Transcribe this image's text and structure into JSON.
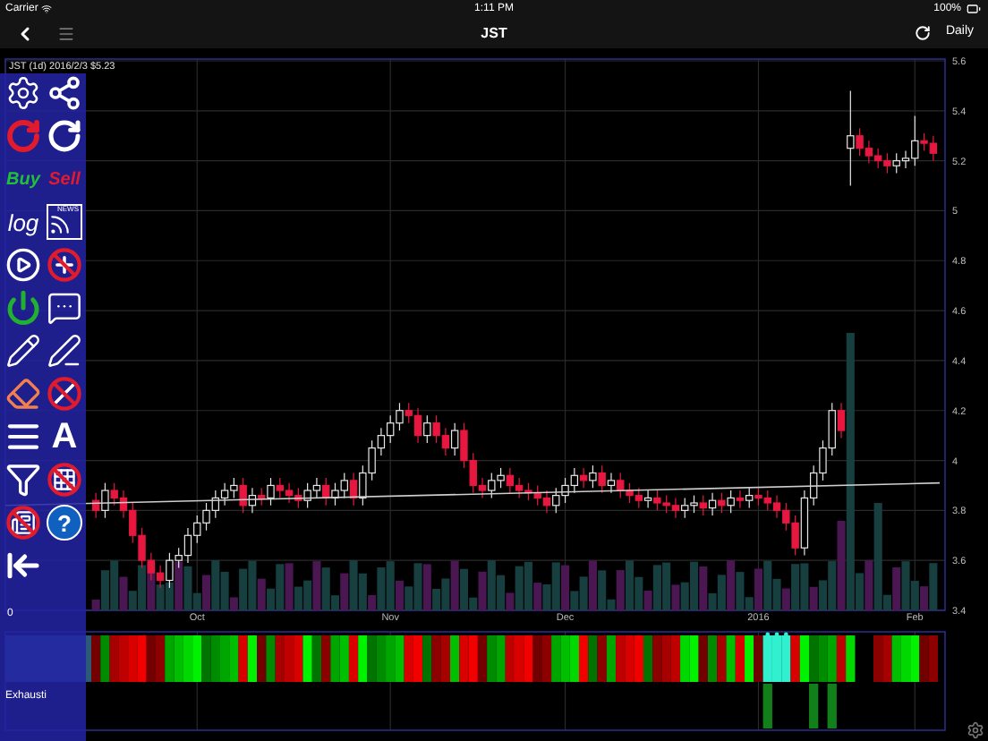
{
  "status_bar": {
    "carrier": "Carrier",
    "time": "1:11 PM",
    "battery": "100%"
  },
  "nav": {
    "title": "JST",
    "interval": "Daily"
  },
  "toolbar": {
    "buy": "Buy",
    "sell": "Sell",
    "log": "log",
    "news": "NEWS",
    "font": "A",
    "help": "?"
  },
  "chart": {
    "zero_label": "0",
    "chart_data": {
      "type": "candlestick",
      "title": "JST (1d) 2016/2/3 $5.23",
      "categories": [
        null,
        null,
        null,
        null,
        null,
        null,
        null,
        null,
        null,
        null,
        null,
        "Oct",
        null,
        null,
        null,
        null,
        null,
        null,
        null,
        null,
        null,
        null,
        null,
        null,
        null,
        null,
        null,
        null,
        null,
        null,
        null,
        null,
        "Nov",
        null,
        null,
        null,
        null,
        null,
        null,
        null,
        null,
        null,
        null,
        null,
        null,
        null,
        null,
        null,
        null,
        null,
        null,
        "Dec",
        null,
        null,
        null,
        null,
        null,
        null,
        null,
        null,
        null,
        null,
        null,
        null,
        null,
        null,
        null,
        null,
        null,
        null,
        null,
        null,
        "2016",
        null,
        null,
        null,
        null,
        null,
        null,
        null,
        null,
        null,
        null,
        null,
        null,
        null,
        null,
        null,
        null,
        "Feb",
        null,
        null
      ],
      "ohlc": [
        [
          3.84,
          3.87,
          3.77,
          3.8
        ],
        [
          3.8,
          3.91,
          3.77,
          3.88
        ],
        [
          3.88,
          3.91,
          3.82,
          3.85
        ],
        [
          3.85,
          3.88,
          3.77,
          3.8
        ],
        [
          3.8,
          3.83,
          3.67,
          3.7
        ],
        [
          3.7,
          3.73,
          3.57,
          3.6
        ],
        [
          3.6,
          3.63,
          3.52,
          3.55
        ],
        [
          3.55,
          3.58,
          3.49,
          3.52
        ],
        [
          3.52,
          3.63,
          3.49,
          3.6
        ],
        [
          3.6,
          3.65,
          3.57,
          3.62
        ],
        [
          3.62,
          3.73,
          3.59,
          3.7
        ],
        [
          3.7,
          3.78,
          3.67,
          3.75
        ],
        [
          3.75,
          3.83,
          3.72,
          3.8
        ],
        [
          3.8,
          3.88,
          3.77,
          3.85
        ],
        [
          3.85,
          3.91,
          3.82,
          3.88
        ],
        [
          3.88,
          3.93,
          3.85,
          3.9
        ],
        [
          3.9,
          3.93,
          3.79,
          3.82
        ],
        [
          3.82,
          3.89,
          3.79,
          3.86
        ],
        [
          3.86,
          3.89,
          3.82,
          3.85
        ],
        [
          3.85,
          3.93,
          3.82,
          3.9
        ],
        [
          3.9,
          3.93,
          3.85,
          3.88
        ],
        [
          3.88,
          3.91,
          3.83,
          3.86
        ],
        [
          3.86,
          3.89,
          3.81,
          3.84
        ],
        [
          3.84,
          3.91,
          3.81,
          3.88
        ],
        [
          3.88,
          3.93,
          3.85,
          3.9
        ],
        [
          3.9,
          3.93,
          3.82,
          3.85
        ],
        [
          3.85,
          3.91,
          3.82,
          3.88
        ],
        [
          3.88,
          3.95,
          3.85,
          3.92
        ],
        [
          3.92,
          3.95,
          3.82,
          3.85
        ],
        [
          3.85,
          3.98,
          3.82,
          3.95
        ],
        [
          3.95,
          4.08,
          3.92,
          4.05
        ],
        [
          4.05,
          4.13,
          4.02,
          4.1
        ],
        [
          4.1,
          4.18,
          4.07,
          4.15
        ],
        [
          4.15,
          4.23,
          4.12,
          4.2
        ],
        [
          4.2,
          4.23,
          4.15,
          4.18
        ],
        [
          4.18,
          4.21,
          4.07,
          4.1
        ],
        [
          4.1,
          4.18,
          4.07,
          4.15
        ],
        [
          4.15,
          4.18,
          4.07,
          4.1
        ],
        [
          4.1,
          4.13,
          4.02,
          4.05
        ],
        [
          4.05,
          4.15,
          4.02,
          4.12
        ],
        [
          4.12,
          4.15,
          3.97,
          4.0
        ],
        [
          4.0,
          4.03,
          3.87,
          3.9
        ],
        [
          3.9,
          3.93,
          3.85,
          3.88
        ],
        [
          3.88,
          3.95,
          3.85,
          3.92
        ],
        [
          3.92,
          3.97,
          3.89,
          3.94
        ],
        [
          3.94,
          3.97,
          3.87,
          3.9
        ],
        [
          3.9,
          3.93,
          3.85,
          3.88
        ],
        [
          3.88,
          3.91,
          3.84,
          3.87
        ],
        [
          3.87,
          3.9,
          3.82,
          3.85
        ],
        [
          3.85,
          3.88,
          3.79,
          3.82
        ],
        [
          3.82,
          3.89,
          3.79,
          3.86
        ],
        [
          3.86,
          3.93,
          3.83,
          3.9
        ],
        [
          3.9,
          3.97,
          3.87,
          3.94
        ],
        [
          3.94,
          3.97,
          3.89,
          3.92
        ],
        [
          3.92,
          3.98,
          3.89,
          3.95
        ],
        [
          3.95,
          3.98,
          3.87,
          3.9
        ],
        [
          3.9,
          3.95,
          3.87,
          3.92
        ],
        [
          3.92,
          3.95,
          3.85,
          3.88
        ],
        [
          3.88,
          3.91,
          3.83,
          3.86
        ],
        [
          3.86,
          3.89,
          3.81,
          3.84
        ],
        [
          3.84,
          3.88,
          3.81,
          3.85
        ],
        [
          3.85,
          3.88,
          3.8,
          3.83
        ],
        [
          3.83,
          3.86,
          3.79,
          3.82
        ],
        [
          3.82,
          3.85,
          3.77,
          3.8
        ],
        [
          3.8,
          3.85,
          3.77,
          3.82
        ],
        [
          3.82,
          3.86,
          3.79,
          3.83
        ],
        [
          3.83,
          3.86,
          3.78,
          3.81
        ],
        [
          3.81,
          3.87,
          3.78,
          3.84
        ],
        [
          3.84,
          3.87,
          3.79,
          3.82
        ],
        [
          3.82,
          3.88,
          3.79,
          3.85
        ],
        [
          3.85,
          3.88,
          3.81,
          3.84
        ],
        [
          3.84,
          3.89,
          3.81,
          3.86
        ],
        [
          3.86,
          3.89,
          3.82,
          3.85
        ],
        [
          3.85,
          3.88,
          3.8,
          3.83
        ],
        [
          3.83,
          3.86,
          3.77,
          3.8
        ],
        [
          3.8,
          3.83,
          3.72,
          3.75
        ],
        [
          3.75,
          3.78,
          3.62,
          3.65
        ],
        [
          3.65,
          3.88,
          3.62,
          3.85
        ],
        [
          3.85,
          3.98,
          3.82,
          3.95
        ],
        [
          3.95,
          4.08,
          3.92,
          4.05
        ],
        [
          4.05,
          4.23,
          4.02,
          4.2
        ],
        [
          4.2,
          4.23,
          4.09,
          4.12
        ],
        [
          5.25,
          5.48,
          5.1,
          5.3
        ],
        [
          5.3,
          5.33,
          5.22,
          5.25
        ],
        [
          5.25,
          5.28,
          5.19,
          5.22
        ],
        [
          5.22,
          5.25,
          5.17,
          5.2
        ],
        [
          5.2,
          5.23,
          5.15,
          5.18
        ],
        [
          5.18,
          5.23,
          5.15,
          5.2
        ],
        [
          5.2,
          5.24,
          5.17,
          5.21
        ],
        [
          5.21,
          5.38,
          5.18,
          5.28
        ],
        [
          5.28,
          5.31,
          5.24,
          5.27
        ],
        [
          5.27,
          5.3,
          5.2,
          5.23
        ]
      ],
      "ylim": [
        3.4,
        5.6
      ],
      "yticks": [
        5.6,
        5.4,
        5.2,
        5,
        4.8,
        4.6,
        4.4,
        4.2,
        4,
        3.8,
        3.6,
        3.4
      ],
      "grid": true
    }
  },
  "indicator": {
    "label": "Exhausti"
  }
}
